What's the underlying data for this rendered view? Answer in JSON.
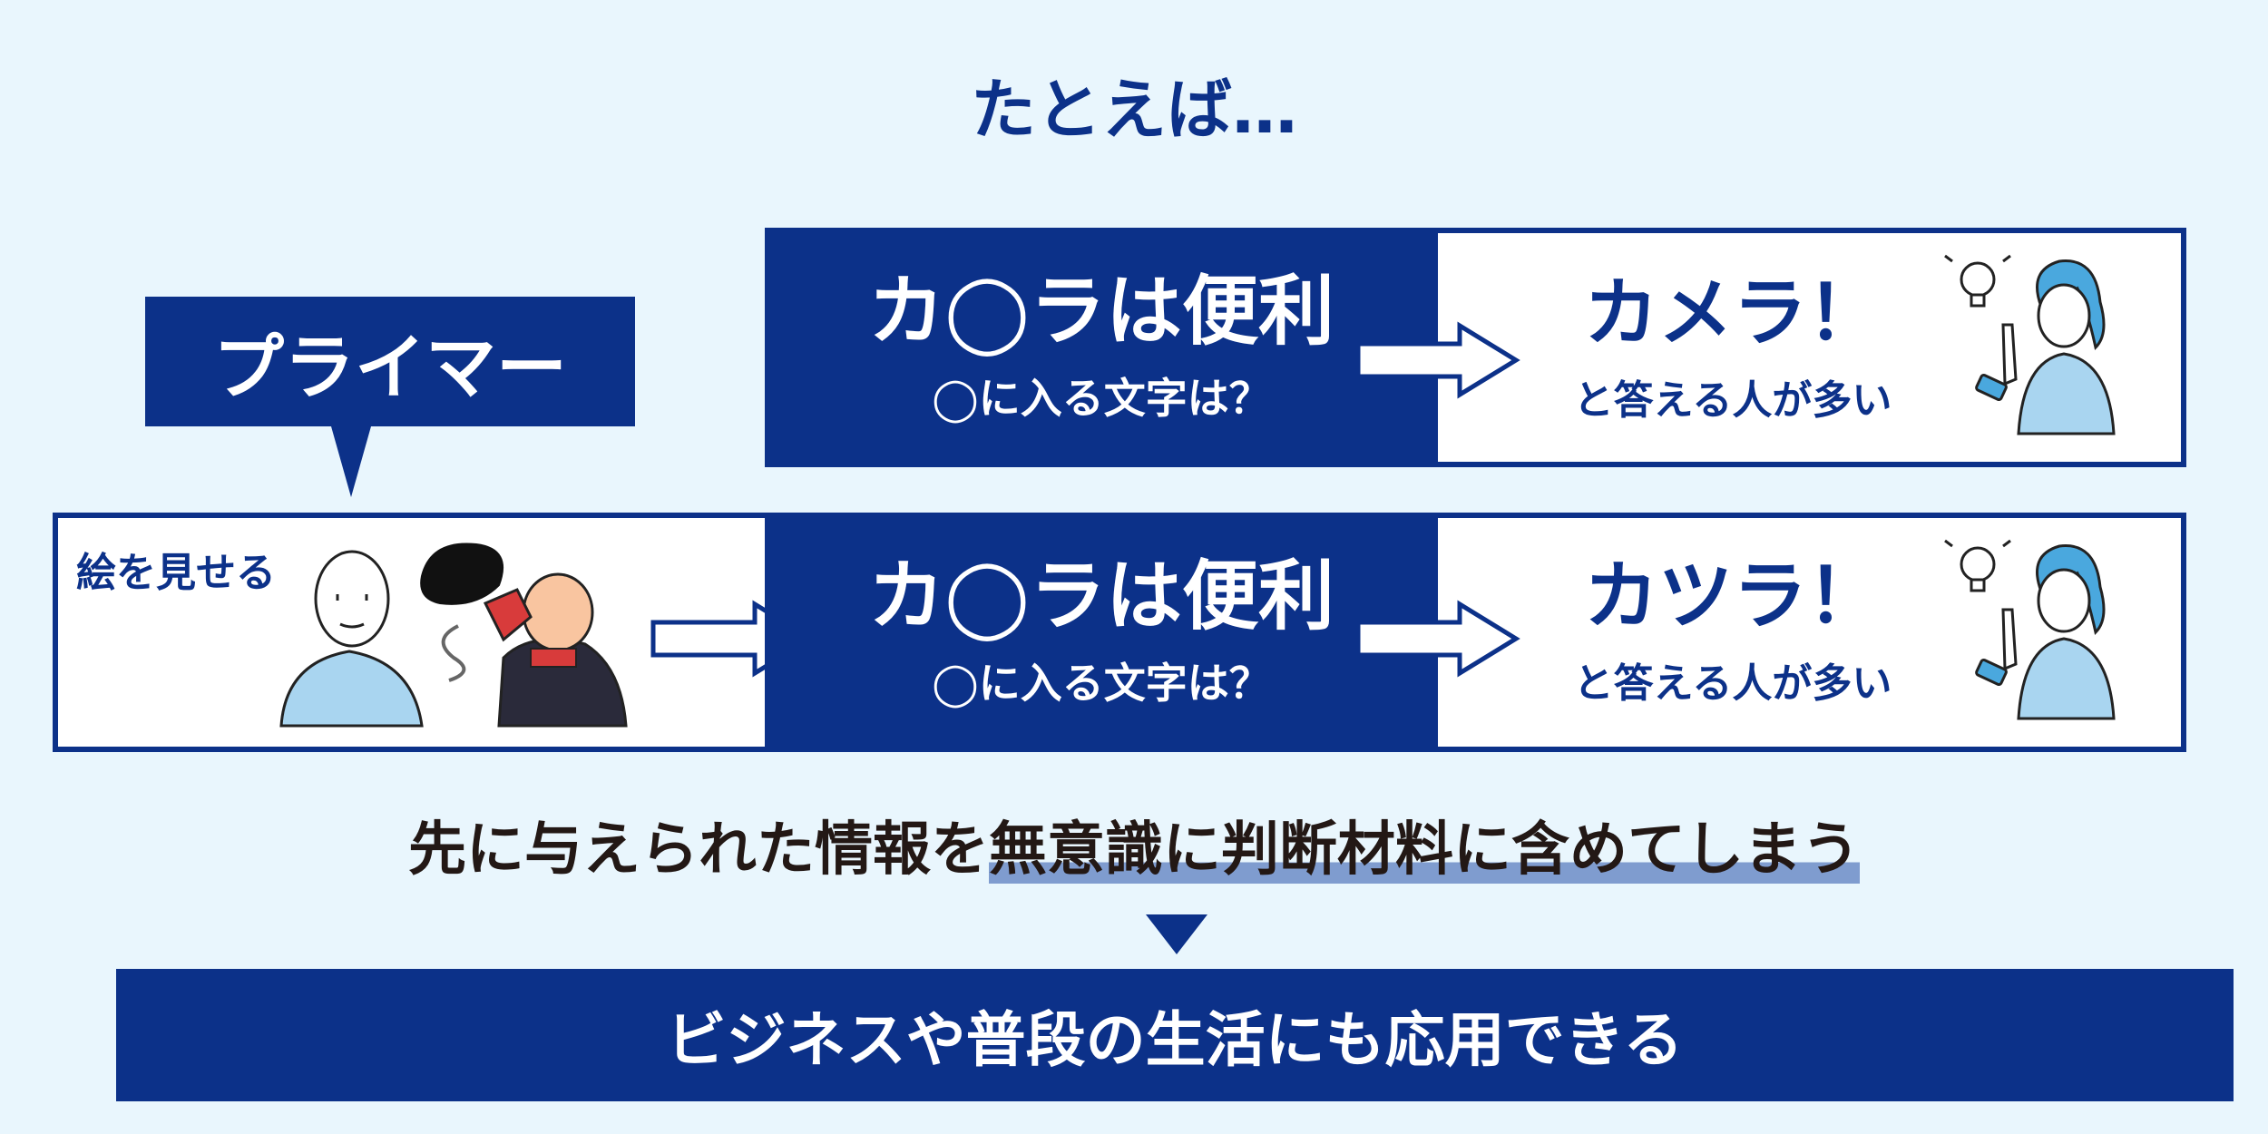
{
  "heading": "たとえば…",
  "primer_label": "プライマー",
  "show_label": "絵を見せる",
  "row1": {
    "question_main": "カ◯ラは便利",
    "question_sub": "◯に入る文字は？",
    "answer_main": "カメラ！",
    "answer_sub": "と答える人が多い"
  },
  "row2": {
    "question_main": "カ◯ラは便利",
    "question_sub": "◯に入る文字は？",
    "answer_main": "カツラ！",
    "answer_sub": "と答える人が多い"
  },
  "summary": {
    "plain": "先に与えられた情報を",
    "highlighted": "無意識に判断材料に含めてしまう"
  },
  "conclusion": "ビジネスや普段の生活にも応用できる",
  "colors": {
    "background": "#e9f6fd",
    "navy": "#0c3189",
    "highlight": "#7f9ccf",
    "text_dark": "#231815",
    "person_light_blue": "#4aa8de"
  },
  "icons": [
    "arrow-right-icon",
    "down-triangle-icon",
    "lightbulb-icon",
    "smartphone-icon"
  ]
}
